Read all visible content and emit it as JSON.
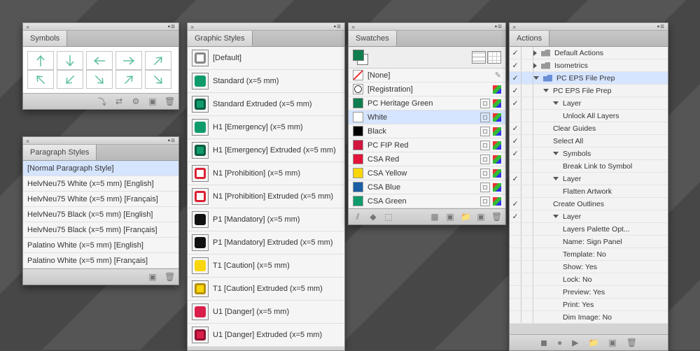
{
  "symbols": {
    "tab": "Symbols"
  },
  "paragraph": {
    "tab": "Paragraph Styles",
    "items": [
      "[Normal Paragraph Style]",
      "HelvNeu75 White (x=5 mm) [English]",
      "HelvNeu75 White (x=5 mm) [Français]",
      "HelvNeu75 Black (x=5 mm) [English]",
      "HelvNeu75 Black (x=5 mm) [Français]",
      "Palatino White (x=5 mm) [English]",
      "Palatino White (x=5 mm) [Français]"
    ]
  },
  "graphic": {
    "tab": "Graphic Styles",
    "items": [
      {
        "label": "[Default]",
        "fill": "#fff",
        "stroke": "#888"
      },
      {
        "label": "Standard (x=5 mm)",
        "fill": "#0f9b6a",
        "stroke": "#0f9b6a"
      },
      {
        "label": "Standard Extruded (x=5 mm)",
        "fill": "#0f9b6a",
        "stroke": "#0b5c3f"
      },
      {
        "label": "H1 [Emergency] (x=5 mm)",
        "fill": "#0f9b6a",
        "stroke": "#0f9b6a"
      },
      {
        "label": "H1 [Emergency] Extruded (x=5 mm)",
        "fill": "#0f9b6a",
        "stroke": "#0b5c3f"
      },
      {
        "label": "N1 [Prohibition] (x=5 mm)",
        "fill": "#fff",
        "stroke": "#d23"
      },
      {
        "label": "N1 [Prohibition] Extruded (x=5 mm)",
        "fill": "#fff",
        "stroke": "#d23"
      },
      {
        "label": "P1 [Mandatory] (x=5 mm)",
        "fill": "#111",
        "stroke": "#111"
      },
      {
        "label": "P1 [Mandatory] Extruded (x=5 mm)",
        "fill": "#111",
        "stroke": "#111"
      },
      {
        "label": "T1 [Caution] (x=5 mm)",
        "fill": "#f8d60a",
        "stroke": "#f8d60a"
      },
      {
        "label": "T1 [Caution] Extruded (x=5 mm)",
        "fill": "#f8d60a",
        "stroke": "#b89000"
      },
      {
        "label": "U1 [Danger] (x=5 mm)",
        "fill": "#d91e4a",
        "stroke": "#d91e4a"
      },
      {
        "label": "U1 [Danger] Extruded (x=5 mm)",
        "fill": "#d91e4a",
        "stroke": "#8f102f"
      }
    ]
  },
  "swatches": {
    "tab": "Swatches",
    "items": [
      {
        "label": "[None]",
        "color": "#fff",
        "none": true
      },
      {
        "label": "[Registration]",
        "color": "#000",
        "reg": true
      },
      {
        "label": "PC Heritage Green",
        "color": "#0f7d4e"
      },
      {
        "label": "White",
        "color": "#fff",
        "sel": true
      },
      {
        "label": "Black",
        "color": "#000"
      },
      {
        "label": "PC FIP Red",
        "color": "#d0153e"
      },
      {
        "label": "CSA Red",
        "color": "#e2123a"
      },
      {
        "label": "CSA Yellow",
        "color": "#f8d60a"
      },
      {
        "label": "CSA Blue",
        "color": "#1a5fa3"
      },
      {
        "label": "CSA Green",
        "color": "#0f9b6a"
      }
    ]
  },
  "actions": {
    "tab": "Actions",
    "items": [
      {
        "chk": true,
        "ind": 1,
        "tri": "closed",
        "folder": true,
        "label": "Default Actions"
      },
      {
        "chk": true,
        "ind": 1,
        "tri": "closed",
        "folder": true,
        "label": "Isometrics"
      },
      {
        "chk": true,
        "ind": 1,
        "tri": "open",
        "folder": true,
        "open": true,
        "label": "PC EPS File Prep",
        "sel": true
      },
      {
        "chk": true,
        "ind": 2,
        "tri": "open",
        "label": "PC EPS File Prep"
      },
      {
        "chk": true,
        "ind": 3,
        "tri": "open",
        "label": "Layer"
      },
      {
        "chk": false,
        "ind": 4,
        "label": "Unlock All Layers"
      },
      {
        "chk": true,
        "ind": 3,
        "label": "Clear Guides"
      },
      {
        "chk": true,
        "ind": 3,
        "label": "Select All"
      },
      {
        "chk": true,
        "ind": 3,
        "tri": "open",
        "label": "Symbols"
      },
      {
        "chk": false,
        "ind": 4,
        "label": "Break Link to Symbol"
      },
      {
        "chk": true,
        "ind": 3,
        "tri": "open",
        "label": "Layer"
      },
      {
        "chk": false,
        "ind": 4,
        "label": "Flatten Artwork"
      },
      {
        "chk": true,
        "ind": 3,
        "label": "Create Outlines"
      },
      {
        "chk": true,
        "ind": 3,
        "tri": "open",
        "label": "Layer"
      },
      {
        "chk": false,
        "ind": 4,
        "label": "Layers Palette Opt..."
      },
      {
        "chk": false,
        "ind": 4,
        "label": "Name: Sign Panel"
      },
      {
        "chk": false,
        "ind": 4,
        "label": "Template: No"
      },
      {
        "chk": false,
        "ind": 4,
        "label": "Show: Yes"
      },
      {
        "chk": false,
        "ind": 4,
        "label": "Lock: No"
      },
      {
        "chk": false,
        "ind": 4,
        "label": "Preview: Yes"
      },
      {
        "chk": false,
        "ind": 4,
        "label": "Print: Yes"
      },
      {
        "chk": false,
        "ind": 4,
        "label": "Dim Image: No"
      }
    ]
  }
}
